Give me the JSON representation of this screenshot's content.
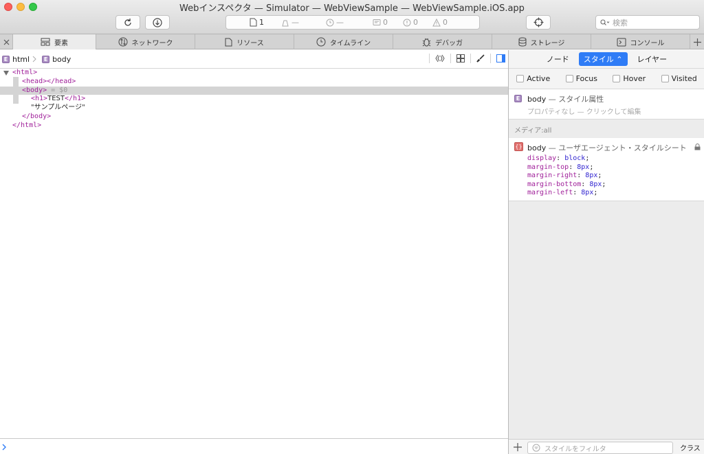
{
  "window": {
    "title": "Webインスペクタ — Simulator — WebViewSample — WebViewSample.iOS.app"
  },
  "toolbar": {
    "reload_icon": "reload-icon",
    "download_icon": "download-icon",
    "resources_count": "1",
    "load_time": "—",
    "duration": "—",
    "logs_count": "0",
    "errors_count": "0",
    "warnings_count": "0",
    "search_placeholder": "検索"
  },
  "tabs": [
    {
      "label": "要素",
      "icon": "elements-icon",
      "active": true
    },
    {
      "label": "ネットワーク",
      "icon": "network-icon",
      "active": false
    },
    {
      "label": "リソース",
      "icon": "resources-icon",
      "active": false
    },
    {
      "label": "タイムライン",
      "icon": "timeline-icon",
      "active": false
    },
    {
      "label": "デバッガ",
      "icon": "debugger-icon",
      "active": false
    },
    {
      "label": "ストレージ",
      "icon": "storage-icon",
      "active": false
    },
    {
      "label": "コンソール",
      "icon": "console-icon",
      "active": false
    }
  ],
  "breadcrumb": {
    "badge": "E",
    "items": [
      "html",
      "body"
    ]
  },
  "dom_tree": {
    "html_open": "<html>",
    "head": "<head></head>",
    "body_open": "<body>",
    "body_ref": " = $0",
    "h1_open": "<h1>",
    "h1_text": "TEST",
    "h1_close": "</h1>",
    "text_node": "\"サンプルページ\"",
    "body_close": "</body>",
    "html_close": "</html>"
  },
  "sidebar": {
    "segments": {
      "node": "ノード",
      "style": "スタイル",
      "layer": "レイヤー"
    },
    "pseudo": [
      "Active",
      "Focus",
      "Hover",
      "Visited"
    ],
    "style_attr": {
      "badge": "E",
      "selector": "body",
      "label": " — スタイル属性",
      "empty": "プロパティなし — クリックして編集"
    },
    "media": "メディア:all",
    "ua_rule": {
      "badge": "{}",
      "selector": "body",
      "label": " — ユーザエージェント・スタイルシート",
      "props": [
        {
          "name": "display",
          "value": "block"
        },
        {
          "name": "margin-top",
          "value": "8px"
        },
        {
          "name": "margin-right",
          "value": "8px"
        },
        {
          "name": "margin-bottom",
          "value": "8px"
        },
        {
          "name": "margin-left",
          "value": "8px"
        }
      ]
    },
    "filter_placeholder": "スタイルをフィルタ",
    "class_button": "クラス"
  },
  "colors": {
    "accent": "#2f7cf6",
    "tag": "#a0209a",
    "value": "#2c1fcf",
    "close": "#fc605c",
    "minimize": "#fdbc40",
    "zoom": "#34c84a"
  }
}
